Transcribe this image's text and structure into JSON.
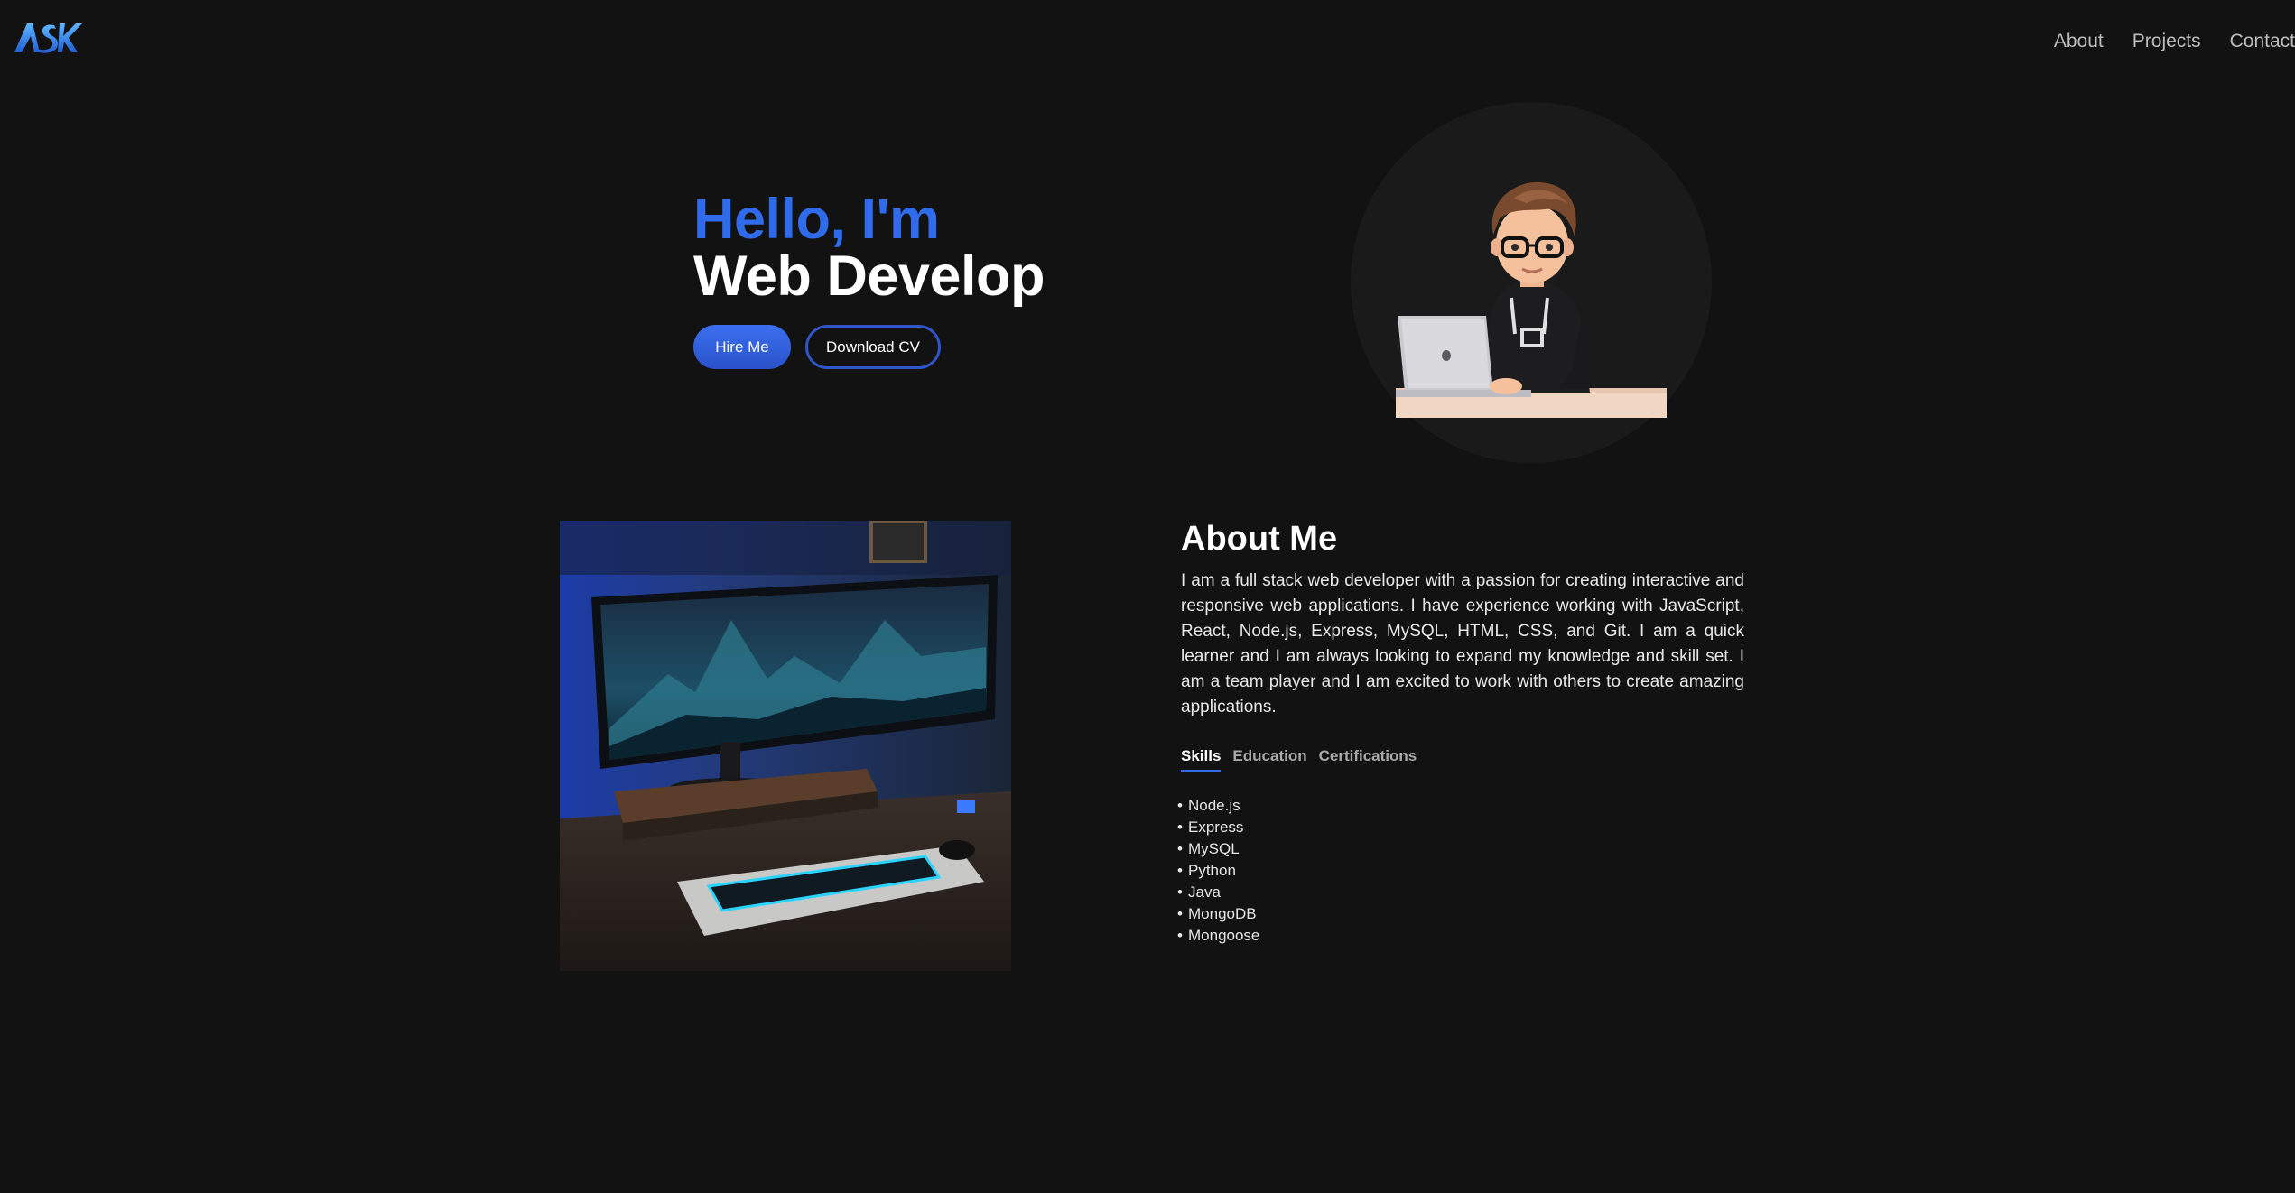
{
  "header": {
    "logo_text": "ASK",
    "nav": [
      {
        "label": "About"
      },
      {
        "label": "Projects"
      },
      {
        "label": "Contact"
      }
    ]
  },
  "hero": {
    "greeting": "Hello, I'm",
    "role": "Web Develop",
    "hire_label": "Hire Me",
    "cv_label": "Download CV"
  },
  "about": {
    "title": "About Me",
    "text": "I am a full stack web developer with a passion for creating interactive and responsive web applications. I have experience working with JavaScript, React, Node.js, Express, MySQL, HTML, CSS, and Git. I am a quick learner and I am always looking to expand my knowledge and skill set. I am a team player and I am excited to work with others to create amazing applications.",
    "tabs": [
      {
        "label": "Skills",
        "active": true
      },
      {
        "label": "Education",
        "active": false
      },
      {
        "label": "Certifications",
        "active": false
      }
    ],
    "skills": [
      "Node.js",
      "Express",
      "MySQL",
      "Python",
      "Java",
      "MongoDB",
      "Mongoose"
    ]
  },
  "colors": {
    "background": "#121212",
    "accent": "#2f6bea",
    "avatar_circle": "#1a1a1a"
  }
}
